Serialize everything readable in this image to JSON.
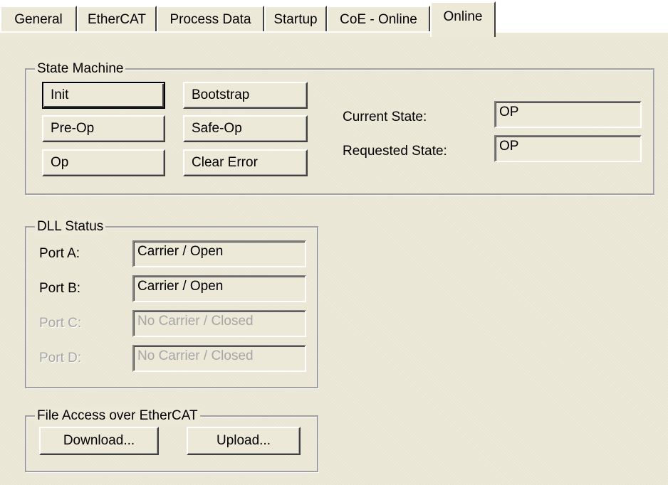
{
  "tabs": [
    {
      "label": "General"
    },
    {
      "label": "EtherCAT"
    },
    {
      "label": "Process Data"
    },
    {
      "label": "Startup"
    },
    {
      "label": "CoE - Online"
    },
    {
      "label": "Online",
      "active": true
    }
  ],
  "state_machine": {
    "title": "State Machine",
    "buttons": {
      "init": "Init",
      "bootstrap": "Bootstrap",
      "preop": "Pre-Op",
      "safeop": "Safe-Op",
      "op": "Op",
      "clear_error": "Clear Error"
    },
    "current_state_label": "Current State:",
    "current_state_value": "OP",
    "requested_state_label": "Requested State:",
    "requested_state_value": "OP"
  },
  "dll_status": {
    "title": "DLL Status",
    "ports": [
      {
        "label": "Port A:",
        "value": "Carrier / Open",
        "enabled": true
      },
      {
        "label": "Port B:",
        "value": "Carrier / Open",
        "enabled": true
      },
      {
        "label": "Port C:",
        "value": "No Carrier / Closed",
        "enabled": false
      },
      {
        "label": "Port D:",
        "value": "No Carrier / Closed",
        "enabled": false
      }
    ]
  },
  "file_access": {
    "title": "File Access over EtherCAT",
    "download_label": "Download...",
    "upload_label": "Upload..."
  },
  "colors": {
    "panel_bg": "#ece9d8",
    "disabled_text": "#a6a6a6"
  }
}
